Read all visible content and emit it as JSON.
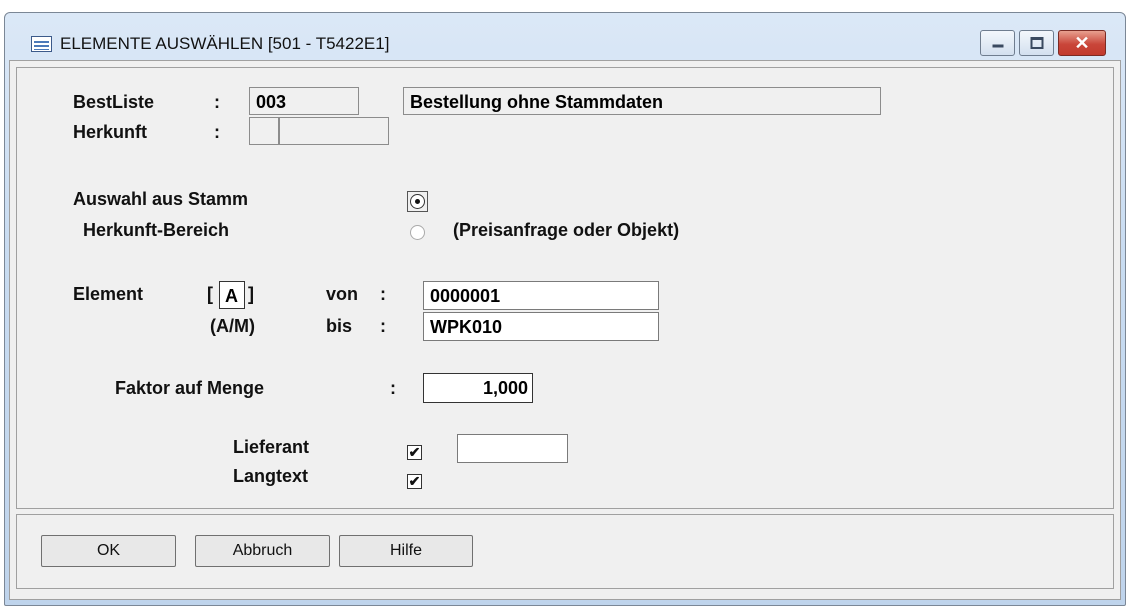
{
  "window": {
    "title": "ELEMENTE AUSWÄHLEN  [501 - T5422E1]"
  },
  "form": {
    "bestliste": {
      "label": "BestListe",
      "colon": ":",
      "value": "003",
      "description": "Bestellung ohne Stammdaten"
    },
    "herkunft": {
      "label": "Herkunft",
      "colon": ":",
      "value1": "",
      "value2": ""
    },
    "auswahl_stamm": {
      "label": "Auswahl aus Stamm",
      "selected": true
    },
    "herkunft_bereich": {
      "label": "Herkunft-Bereich",
      "option_text": "(Preisanfrage oder Objekt)",
      "selected": false
    },
    "element": {
      "label": "Element",
      "type_open": "[",
      "type_value": "A",
      "type_close": "]",
      "type_hint": "(A/M)",
      "von_label": "von",
      "bis_label": "bis",
      "colon": ":",
      "von_value": "0000001",
      "bis_value": "WPK010"
    },
    "faktor": {
      "label": "Faktor auf Menge",
      "colon": ":",
      "value": "1,000"
    },
    "lieferant": {
      "label": "Lieferant",
      "checked": true,
      "value": ""
    },
    "langtext": {
      "label": "Langtext",
      "checked": true
    }
  },
  "buttons": {
    "ok": "OK",
    "abbruch": "Abbruch",
    "hilfe": "Hilfe"
  },
  "icons": {
    "window": "table-icon",
    "check": "✔"
  }
}
